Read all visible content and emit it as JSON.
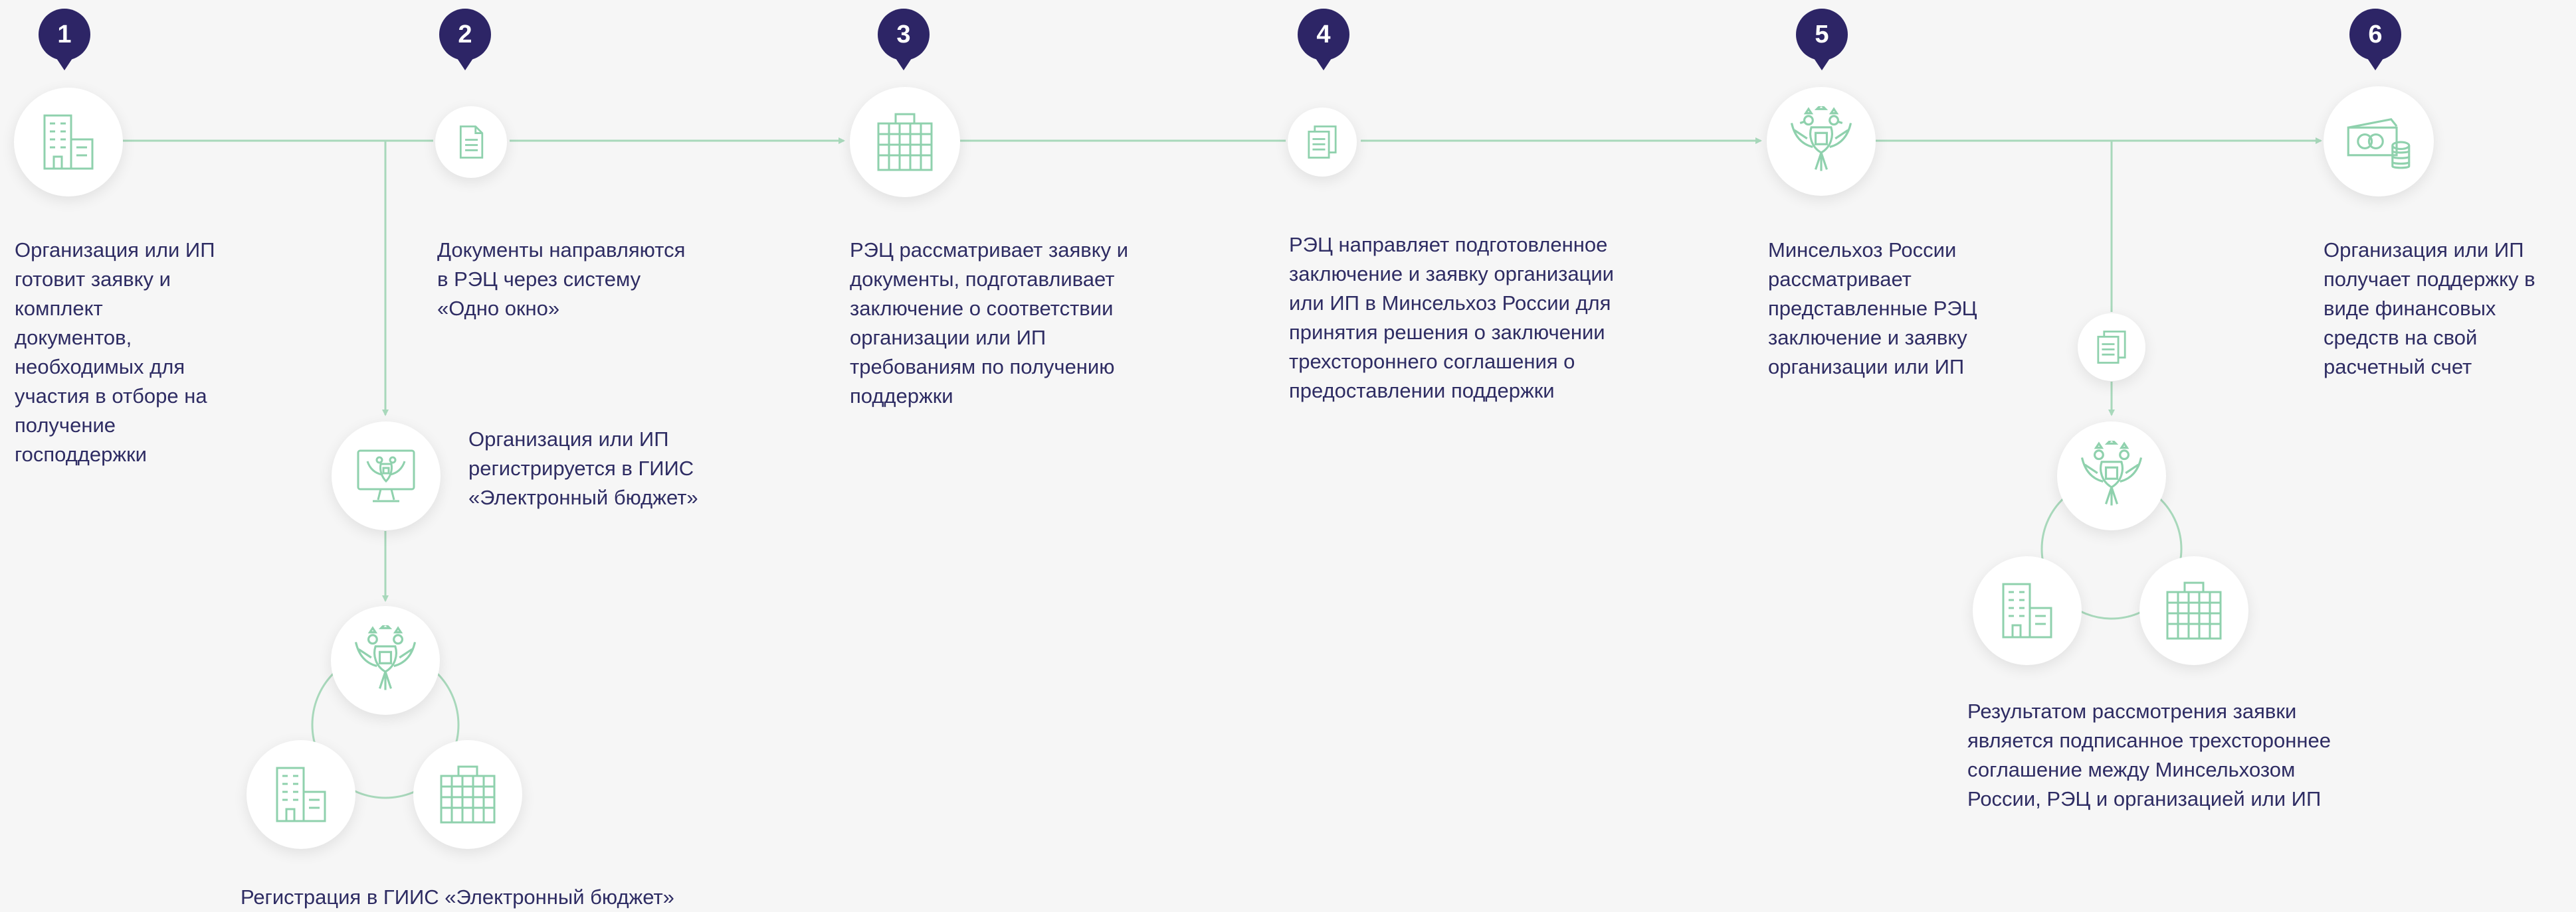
{
  "steps": [
    {
      "number": "1",
      "text": "Организация или ИП\nготовит  заявку и\nкомплект\nдокументов,\nнеобходимых для\nучастия в отборе на\nполучение\nгосподдержки"
    },
    {
      "number": "2",
      "text": "Документы направляются\nв РЭЦ через систему\n«Одно окно»"
    },
    {
      "number": "3",
      "text": "РЭЦ рассматривает заявку и\nдокументы, подготавливает\nзаключение о соответствии\nорганизации или ИП\nтребованиям  по получению\nподдержки"
    },
    {
      "number": "4",
      "text": "РЭЦ направляет подготовленное\nзаключение и заявку организации\nили ИП в  Минсельхоз России для\nпринятия  решения о заключении\nтрехстороннего соглашения о\nпредоставлении поддержки"
    },
    {
      "number": "5",
      "text": "Минсельхоз России\nрассматривает\nпредставленные РЭЦ\nзаключение и заявку\nорганизации или ИП"
    },
    {
      "number": "6",
      "text": "Организация или ИП\nполучает  поддержку в\nвиде  финансовых\nсредств на  свой\nрасчетный счет"
    }
  ],
  "branch_registration": {
    "text": "Организация или ИП\nрегистрируется в  ГИИС\n«Электронный бюджет»",
    "caption": "Регистрация в ГИИС «Электронный бюджет»"
  },
  "branch_agreement": {
    "caption": "Результатом рассмотрения заявки\nявляется подписанное трехстороннее\nсоглашение между Минсельхозом\nРоссии, РЭЦ и организацией или ИП"
  },
  "icons": {
    "step1": "office-building-icon",
    "step2": "document-icon",
    "step3": "multistory-building-icon",
    "step4": "documents-stack-icon",
    "step5": "double-headed-eagle-emblem-icon",
    "step6": "money-and-coins-icon",
    "registration": "monitor-with-emblem-icon",
    "agreement_document": "documents-stack-icon"
  },
  "colors": {
    "background": "#f6f6f6",
    "badge": "#2d2566",
    "text": "#2e2c63",
    "line": "#a8d8bb",
    "icon": "#8fd1ad"
  }
}
